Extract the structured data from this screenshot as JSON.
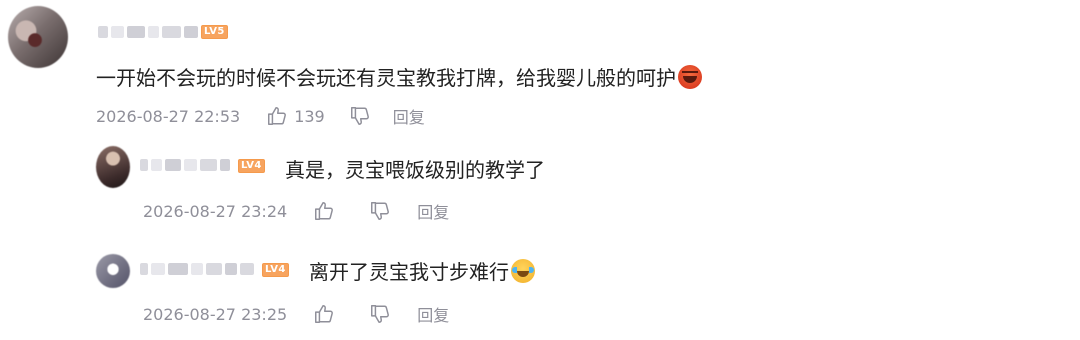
{
  "comments": [
    {
      "level": "LV5",
      "text": "一开始不会玩的时候不会玩还有灵宝教我打牌，给我婴儿般的呵护",
      "emoji": "angry-face-emoji",
      "time": "2026-08-27 22:53",
      "likes": "139",
      "reply_label": "回复"
    },
    {
      "level": "LV4",
      "text": "真是，灵宝喂饭级别的教学了",
      "time": "2026-08-27 23:24",
      "likes": "",
      "reply_label": "回复"
    },
    {
      "level": "LV4",
      "text": "离开了灵宝我寸步难行",
      "emoji": "crying-face-emoji",
      "time": "2026-08-27 23:25",
      "likes": "",
      "reply_label": "回复"
    }
  ],
  "colors": {
    "text": "#222222",
    "meta": "#8f8f99",
    "level_badge": "#f59a4c"
  }
}
